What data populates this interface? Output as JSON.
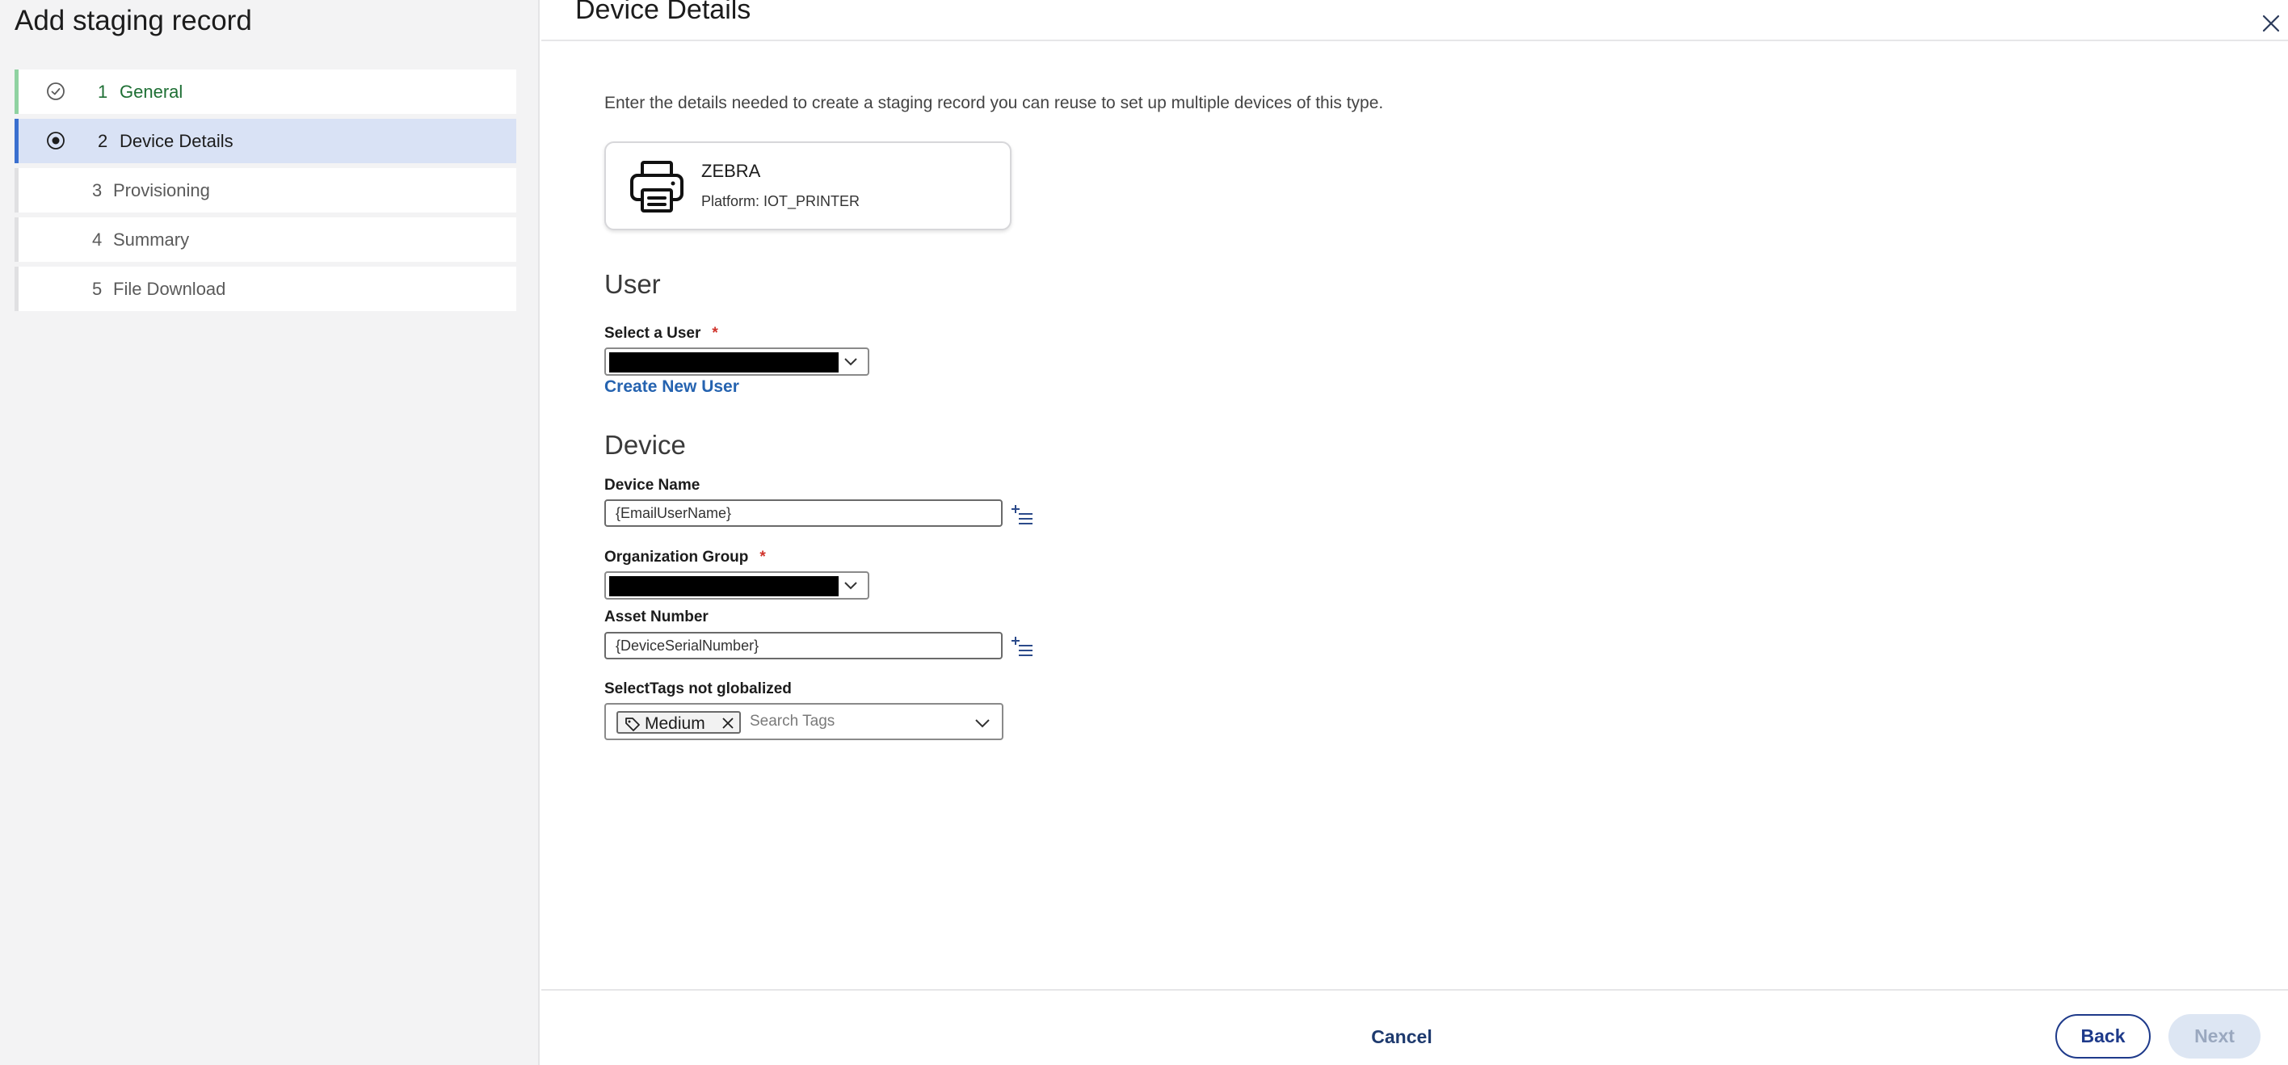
{
  "wizard": {
    "title": "Add staging record",
    "steps": [
      {
        "num": "1",
        "label": "General",
        "state": "done"
      },
      {
        "num": "2",
        "label": "Device Details",
        "state": "active"
      },
      {
        "num": "3",
        "label": "Provisioning",
        "state": "pending"
      },
      {
        "num": "4",
        "label": "Summary",
        "state": "pending"
      },
      {
        "num": "5",
        "label": "File Download",
        "state": "pending"
      }
    ]
  },
  "panel": {
    "title": "Device Details",
    "description": "Enter the details needed to create a staging record you can reuse to set up multiple devices of this type.",
    "device": {
      "brand": "ZEBRA",
      "platform": "Platform: IOT_PRINTER",
      "icon": "printer-icon"
    }
  },
  "user_section": {
    "heading": "User",
    "select_label": "Select a User",
    "required_mark": "*",
    "create_link": "Create New User"
  },
  "device_section": {
    "heading": "Device",
    "device_name_label": "Device Name",
    "device_name_value": "{EmailUserName}",
    "org_group_label": "Organization Group",
    "required_mark": "*",
    "asset_number_label": "Asset Number",
    "asset_number_value": "{DeviceSerialNumber}",
    "tags_label": "SelectTags not globalized",
    "tag_chip": "Medium",
    "tags_placeholder": "Search Tags"
  },
  "footer": {
    "cancel": "Cancel",
    "back": "Back",
    "next": "Next"
  },
  "colors": {
    "active_step_bg": "#d9e2f5",
    "active_step_border": "#3a6fcf",
    "done_step_text": "#1e6f34",
    "link": "#2563b0",
    "required": "#d0332b",
    "primary_outline": "#1e3a8a",
    "disabled_bg": "#dde6f3"
  }
}
